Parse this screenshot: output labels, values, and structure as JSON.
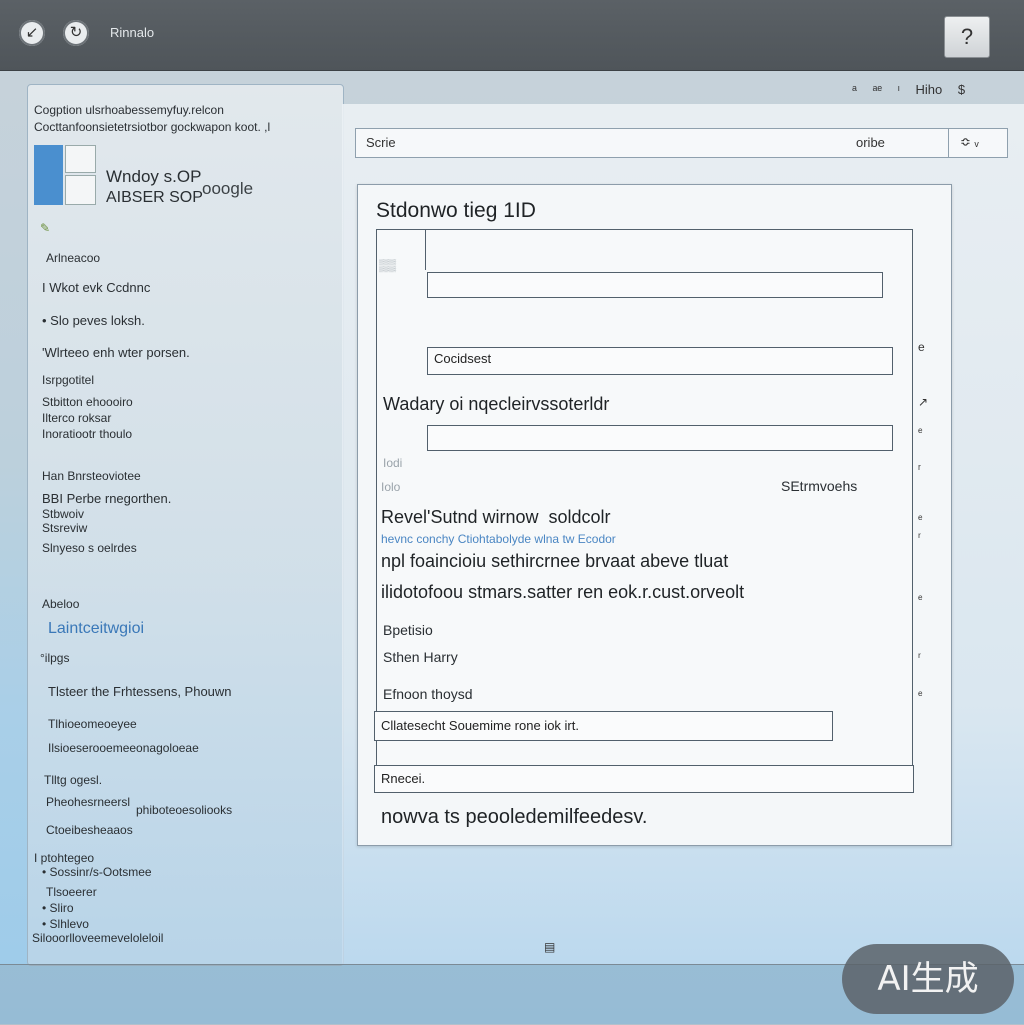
{
  "titlebar": {
    "title": "Rinnalo",
    "help_icon": "?"
  },
  "toolbar": {
    "icons": [
      "ᵃ",
      "ᵃᵉ",
      "ᶦ",
      "Hiho",
      "$"
    ]
  },
  "left_panel": {
    "header_line1": "Cogption ulsrhoabessemyfuy.relcon",
    "header_line2": "Cocttanfoonsietetrsiotbor  gockwapon koot. ,l",
    "app_name_line1": "Wndoy s.OP",
    "app_name_line2": "AIBSER SOP",
    "app_badge": "ooogle",
    "items": [
      "Arlneacoo",
      "I Wkot evk Ccdnnc",
      "• Slo peves loksh.",
      "'Wlrteeo enh wter porsen.",
      "Isrpgotitel",
      "Stbitton ehoooiro",
      "Ilterco roksar",
      "Inoratiootr thoulo",
      "Han Bnrsteoviotee",
      "BBI Perbe rnegorthen.",
      "Stbwoiv",
      "Stsreviw",
      "Slnyeso s oelrdes",
      "Abeloo"
    ],
    "link": "Laintceitwgioi",
    "items2": [
      "°ilpgs",
      "Tlsteer the Frhtessens, Phouwn",
      "Tlhioeomeoeyee",
      "Ilsioeserooemeeonagoloeae",
      "Tlltg ogesl.",
      "Pheohesrneersl",
      "phiboteoesoliooks",
      "Ctoeibesheaaos",
      "I ptohtegeo",
      "• Sossinr/s-Ootsmee",
      "Tlsoeerer",
      "• Sliro",
      "• Slhlevo",
      "Silooorlloveemeveloleloil"
    ]
  },
  "search": {
    "label": "Scrie",
    "sort_label": "oribe",
    "stepper": "≎  ᵥ"
  },
  "dialog": {
    "title": "Stdonwo tieg 1ID",
    "field1": "",
    "field2": "Cocidsest",
    "heading1": "Wadary oi nqecleirvssoterldr",
    "field3": "",
    "ghost1": "Iodi",
    "ghost2": "Iolo",
    "right_label": "SEtrmvoehs",
    "heading2": "Revel'Sutnd wirnow  soldcolr",
    "blue_line": "hevnc conchy Ctiohtabolyde wlna tw Ecodor",
    "para1": "npl foaincioiu sethircrnee brvaat abeve tluat",
    "para2": "ilidotofoou stmars.satter ren eok.r.cust.orveolt",
    "opt1": "Bpetisio",
    "opt2": "Sthen Harry",
    "opt3": "Efnoon thoysd",
    "option_field": "Cllatesecht Souemime rone iok irt.",
    "bottom_field": "Rnecei.",
    "footer": "nowva ts peooledemilfeedesv."
  },
  "side_marks": [
    "e",
    "↗",
    "ᵉ",
    "ᵣ",
    "ᵉ",
    "ʳ",
    "ᵉ",
    "ʳ",
    "ᵉ"
  ],
  "badge": "AI生成"
}
